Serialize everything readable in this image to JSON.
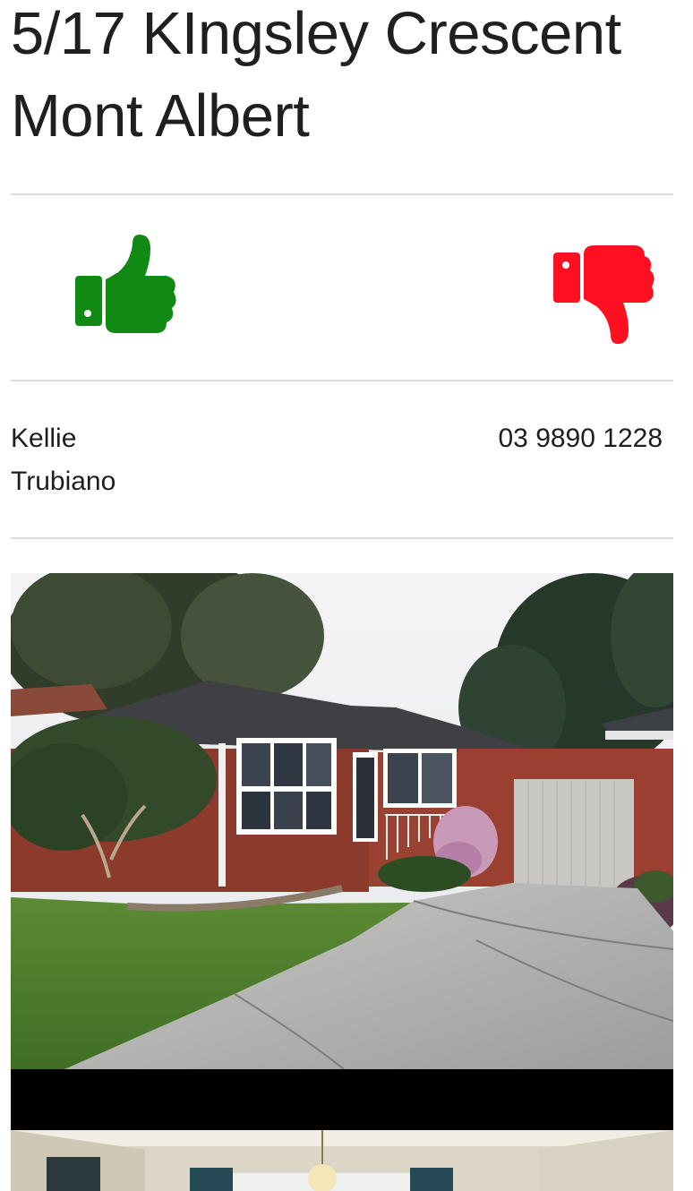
{
  "listing": {
    "address_line1": "5/17 KIngsley Crescent",
    "address_line2": "Mont Albert"
  },
  "votes": {
    "like_icon": "thumbs-up-icon",
    "like_color": "#118a14",
    "dislike_icon": "thumbs-down-icon",
    "dislike_color": "#ff1020"
  },
  "agent": {
    "first_name": "Kellie",
    "last_name": "Trubiano",
    "phone": "03 9890 1228"
  },
  "photos": [
    {
      "subject": "exterior-brick-unit-with-garage"
    },
    {
      "subject": "interior-living-room"
    }
  ]
}
